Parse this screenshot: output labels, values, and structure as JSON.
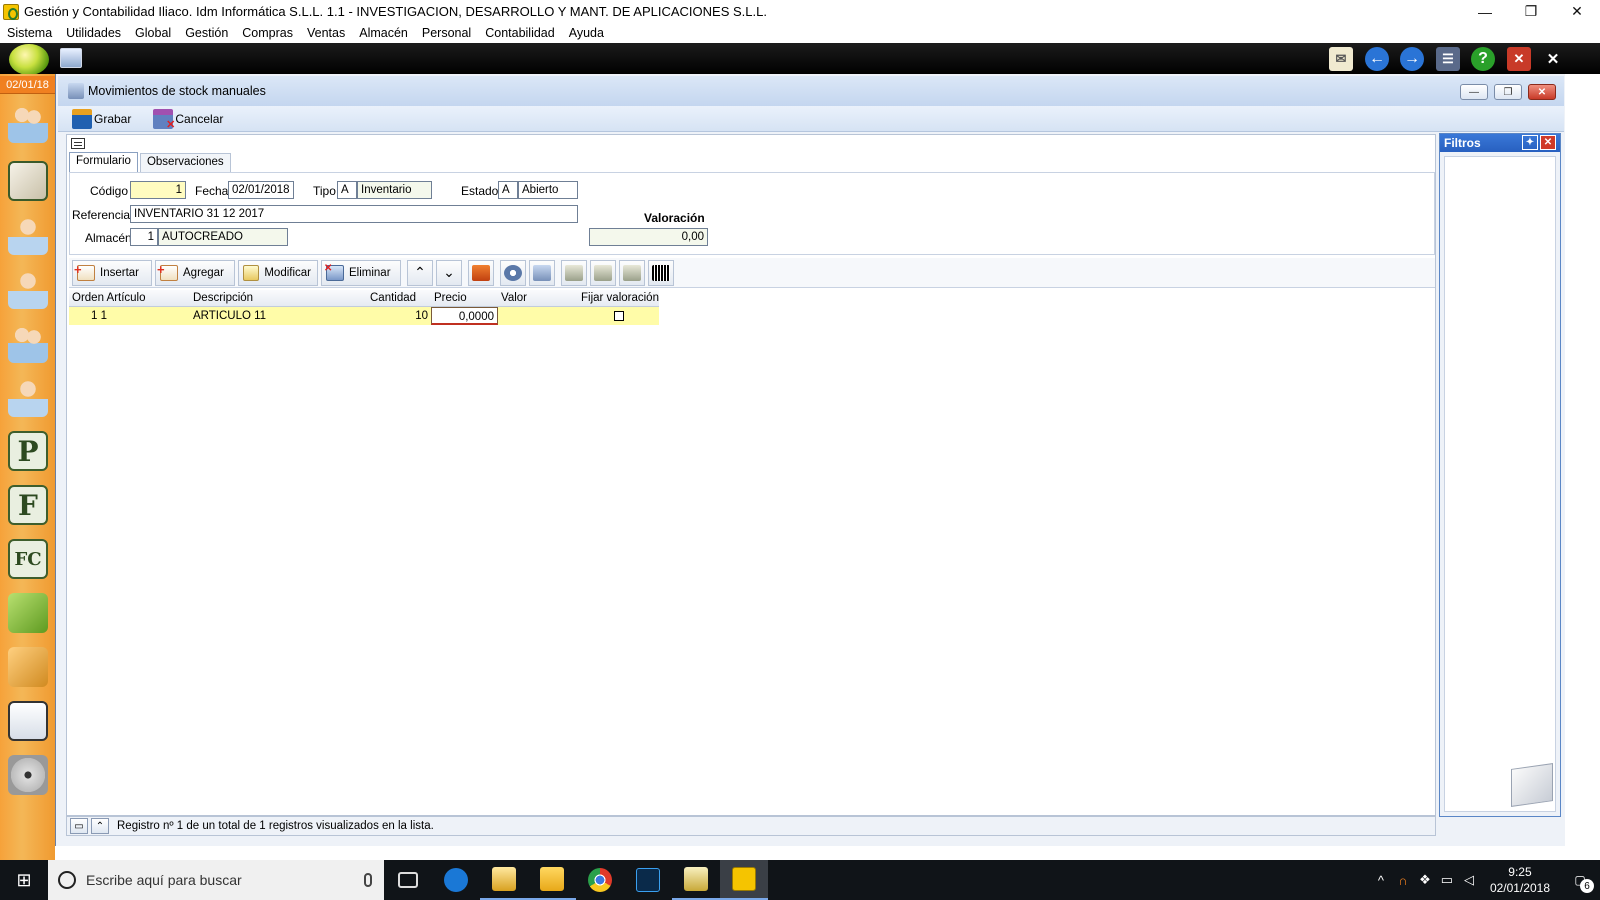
{
  "window": {
    "title": "Gestión y Contabilidad Iliaco. Idm Informática S.L.L. 1.1 - INVESTIGACION, DESARROLLO Y MANT. DE APLICACIONES S.L.L.",
    "minimize": "—",
    "restore": "❐",
    "close": "✕"
  },
  "menu": [
    "Sistema",
    "Utilidades",
    "Global",
    "Gestión",
    "Compras",
    "Ventas",
    "Almacén",
    "Personal",
    "Contabilidad",
    "Ayuda"
  ],
  "sidebar": {
    "date": "02/01/18",
    "letters": {
      "p": "P",
      "f": "F",
      "fc": "FC"
    }
  },
  "form": {
    "title": "Movimientos de stock manuales",
    "commands": {
      "save": "Grabar",
      "cancel": "Cancelar"
    },
    "tabs": [
      "Formulario",
      "Observaciones"
    ],
    "fields": {
      "codigo_label": "Código",
      "codigo": "1",
      "fecha_label": "Fecha",
      "fecha": "02/01/2018",
      "tipo_label": "Tipo",
      "tipo_code": "A",
      "tipo_desc": "Inventario",
      "estado_label": "Estado",
      "estado_code": "A",
      "estado_desc": "Abierto",
      "referencia_label": "Referencia",
      "referencia": "INVENTARIO 31 12 2017",
      "almacen_label": "Almacén",
      "almacen_code": "1",
      "almacen_desc": "AUTOCREADO",
      "valoracion_label": "Valoración",
      "valoracion": "0,00"
    },
    "grid_buttons": {
      "insert": "Insertar",
      "add": "Agregar",
      "modify": "Modificar",
      "delete": "Eliminar"
    },
    "grid": {
      "columns": [
        "Orden Artículo",
        "Descripción",
        "Cantidad",
        "Precio",
        "Valor",
        "Fijar valoración"
      ],
      "rows": [
        {
          "orden": "1  1",
          "descripcion": "ARTICULO 11",
          "cantidad": "10",
          "precio": "0,0000",
          "valor": "",
          "fijar": false
        }
      ]
    },
    "status": "Registro nº 1 de un total de 1 registros visualizados en la lista."
  },
  "filters": {
    "title": "Filtros"
  },
  "taskbar": {
    "search_placeholder": "Escribe aquí para buscar",
    "time": "9:25",
    "date": "02/01/2018",
    "notifications": "6"
  },
  "colors": {
    "sidebar": "#f4b757",
    "highlight_row": "#fffca8",
    "field_yellow": "#fffcc0",
    "filters_header": "#2860c0"
  }
}
